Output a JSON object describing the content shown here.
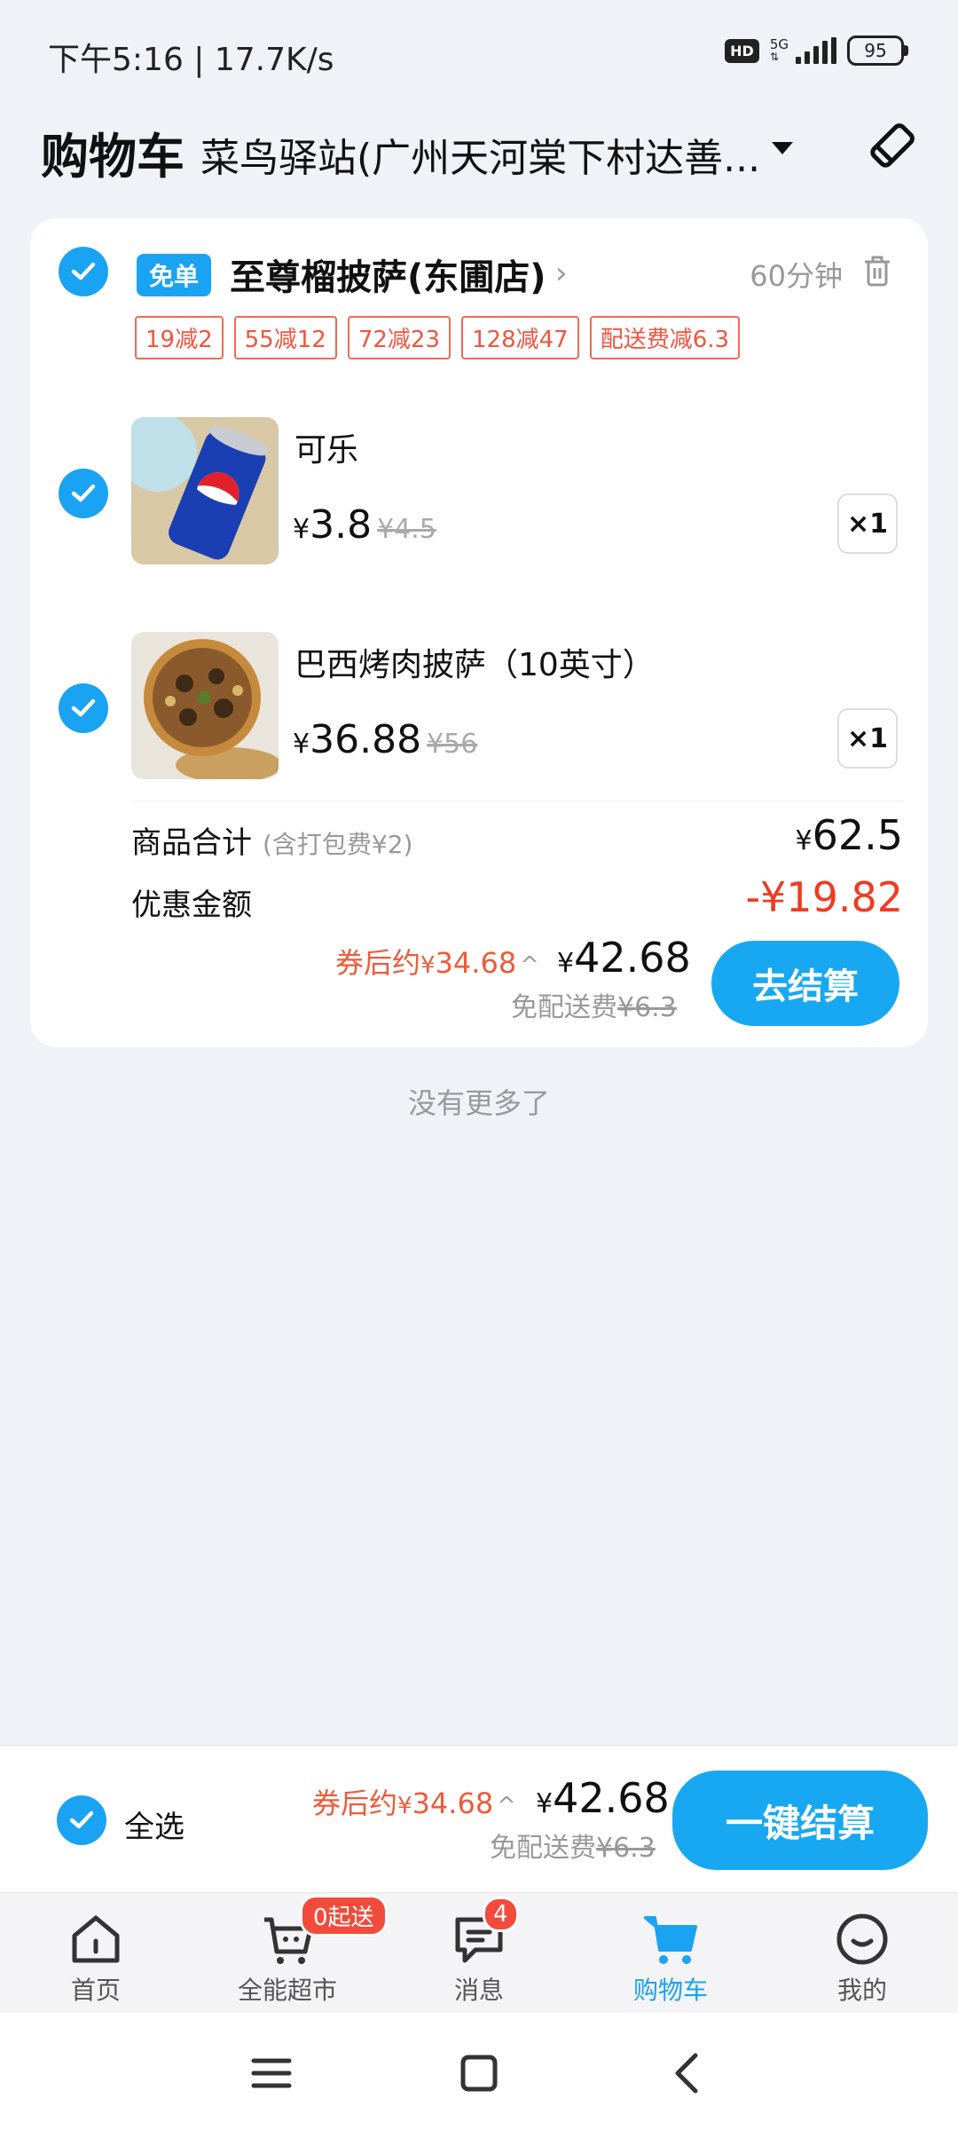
{
  "status_bar": {
    "time": "下午5:16 | 17.7K/s",
    "hd": "HD",
    "network": "5G",
    "battery": "95"
  },
  "header": {
    "title": "购物车",
    "address": "菜鸟驿站(广州天河棠下村达善...",
    "icons": [
      "chevron-down-icon",
      "edit-icon"
    ]
  },
  "store": {
    "badge": "免单",
    "name": "至尊榴披萨(东圃店)",
    "chevron": "›",
    "eta": "60分钟",
    "promos": [
      "19减2",
      "55减12",
      "72减23",
      "128减47",
      "配送费减6.3"
    ],
    "items": [
      {
        "name": "可乐",
        "yen": "¥",
        "price": "3.8",
        "old_price": "¥4.5",
        "qty": "×1",
        "image": "pepsi-can"
      },
      {
        "name": "巴西烤肉披萨（10英寸）",
        "yen": "¥",
        "price": "36.88",
        "old_price": "¥56",
        "qty": "×1",
        "image": "pizza"
      }
    ],
    "subtotal_label": "商品合计",
    "subtotal_note": "(含打包费¥2)",
    "subtotal_yen": "¥",
    "subtotal_value": "62.5",
    "discount_label": "优惠金额",
    "discount_value": "-¥19.82",
    "coupon_prefix": "券后约",
    "coupon_yen": "¥",
    "coupon_value": "34.68",
    "coupon_arrow": "^",
    "total_yen": "¥",
    "total_value": "42.68",
    "free_fee_label": "免配送费",
    "free_fee_old": "¥6.3",
    "checkout_label": "去结算"
  },
  "no_more": "没有更多了",
  "bottom_bar": {
    "select_all": "全选",
    "coupon_prefix": "券后约",
    "coupon_yen": "¥",
    "coupon_value": "34.68",
    "coupon_arrow": "^",
    "total_yen": "¥",
    "total_value": "42.68",
    "free_fee_label": "免配送费",
    "free_fee_old": "¥6.3",
    "checkout_label": "一键结算"
  },
  "tabs": [
    {
      "label": "首页",
      "icon": "home-icon"
    },
    {
      "label": "全能超市",
      "icon": "supermarket-icon",
      "badge": "0起送"
    },
    {
      "label": "消息",
      "icon": "message-icon",
      "badge": "4"
    },
    {
      "label": "购物车",
      "icon": "cart-icon",
      "active": true
    },
    {
      "label": "我的",
      "icon": "profile-icon"
    }
  ],
  "colors": {
    "accent": "#1aa3f2",
    "price_red": "#ef3b22",
    "background": "#eff2f7"
  }
}
